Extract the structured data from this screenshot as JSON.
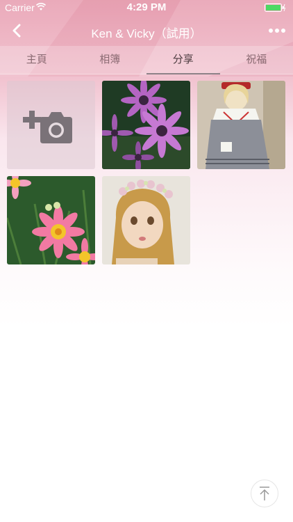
{
  "status_bar": {
    "carrier": "Carrier",
    "time": "4:29 PM"
  },
  "nav": {
    "title": "Ken & Vicky（試用）"
  },
  "tabs": [
    {
      "label": "主頁"
    },
    {
      "label": "相簿"
    },
    {
      "label": "分享",
      "active": true
    },
    {
      "label": "祝福"
    }
  ],
  "photos": [
    {
      "subject": "purple-daisies"
    },
    {
      "subject": "doll-sitting"
    },
    {
      "subject": "pink-daisies"
    },
    {
      "subject": "doll-portrait"
    }
  ],
  "icons": {
    "back": "back-chevron-icon",
    "more": "more-dots-icon",
    "add_photo": "add-camera-icon",
    "scroll_top": "scroll-top-icon",
    "wifi": "wifi-icon",
    "battery": "battery-icon"
  },
  "colors": {
    "accent": "#e8a0b2",
    "tab_active": "#4a3a3e",
    "tab_inactive": "#8a6a72"
  }
}
